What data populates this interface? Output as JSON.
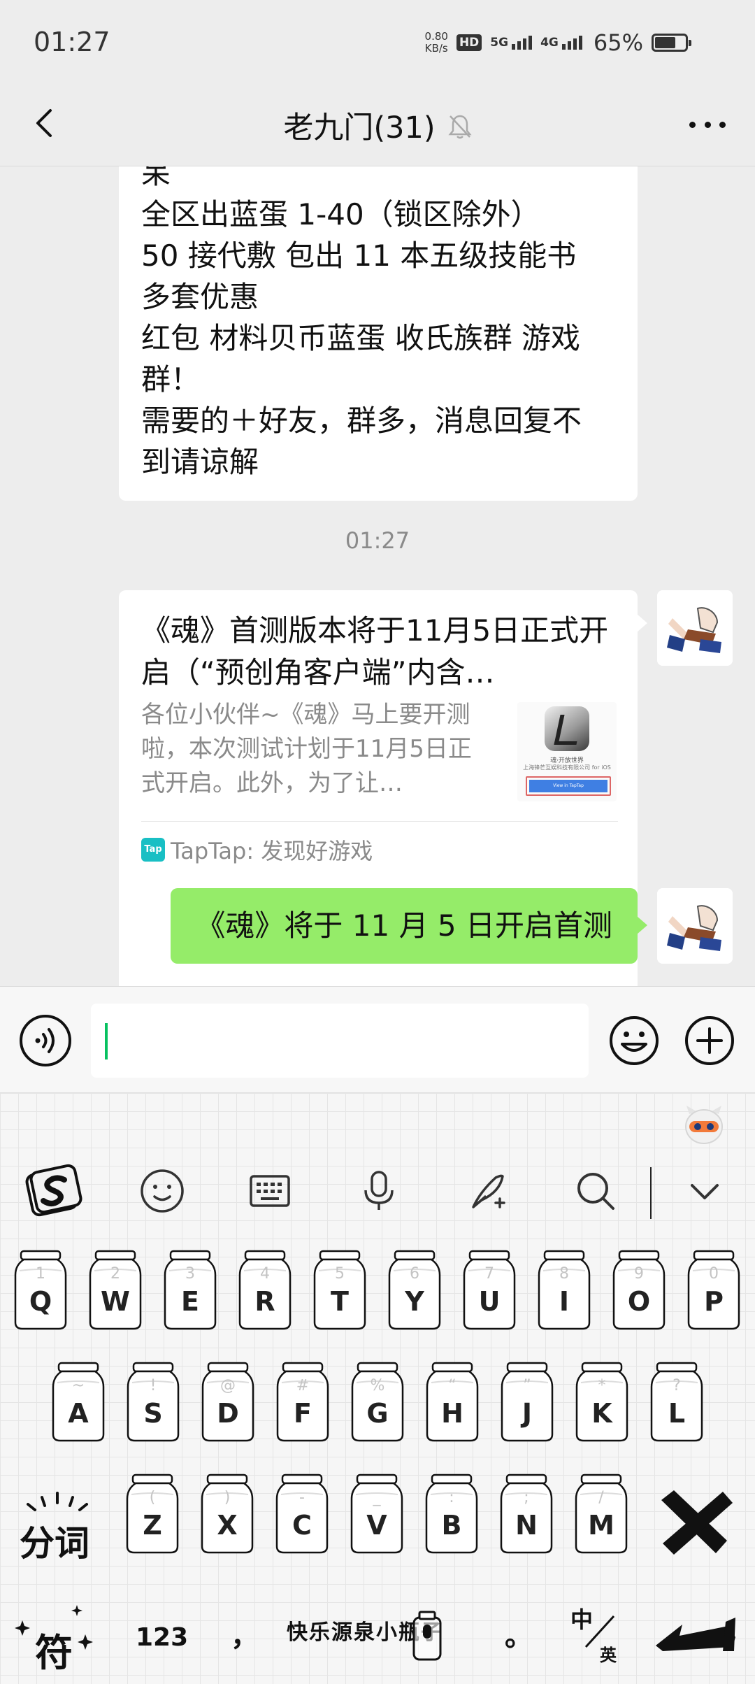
{
  "status": {
    "time": "01:27",
    "net_speed_value": "0.80",
    "net_speed_unit": "KB/s",
    "hd_label": "HD",
    "sim1": "5G",
    "sim2": "4G",
    "battery_percent": "65%",
    "battery_level": 0.65
  },
  "header": {
    "title": "老九门(31)"
  },
  "chat": {
    "prev_message_lines": [
      "呆",
      "全区出蓝蛋 1-40（锁区除外）",
      "50 接代敷 包出 11 本五级技能书",
      "多套优惠",
      "红包 材料贝币蓝蛋 收氏族群 游戏",
      "群！",
      "需要的＋好友，群多，消息回复不",
      "到请谅解"
    ],
    "timestamp": "01:27",
    "card": {
      "title": "《魂》首测版本将于11月5日正式开启（“预创角客户端”内含…",
      "description": "各位小伙伴~《魂》马上要开测啦，本次测试计划于11月5日正式开启。此外，为了让…",
      "thumb_line1": "魂·开放世界",
      "thumb_line2": "上海锋芒互娱科技有限公司 for iOS",
      "thumb_button": "View in TapTap",
      "source_logo": "Tap",
      "source": "TapTap: 发现好游戏"
    },
    "sent_message": "《魂》将于 11 月 5 日开启首测"
  },
  "keyboard": {
    "rows": [
      [
        {
          "k": "Q",
          "s": "1"
        },
        {
          "k": "W",
          "s": "2"
        },
        {
          "k": "E",
          "s": "3"
        },
        {
          "k": "R",
          "s": "4"
        },
        {
          "k": "T",
          "s": "5"
        },
        {
          "k": "Y",
          "s": "6"
        },
        {
          "k": "U",
          "s": "7"
        },
        {
          "k": "I",
          "s": "8"
        },
        {
          "k": "O",
          "s": "9"
        },
        {
          "k": "P",
          "s": "0"
        }
      ],
      [
        {
          "k": "A",
          "s": "~"
        },
        {
          "k": "S",
          "s": "!"
        },
        {
          "k": "D",
          "s": "@"
        },
        {
          "k": "F",
          "s": "#"
        },
        {
          "k": "G",
          "s": "%"
        },
        {
          "k": "H",
          "s": "“"
        },
        {
          "k": "J",
          "s": "”"
        },
        {
          "k": "K",
          "s": "*"
        },
        {
          "k": "L",
          "s": "?"
        }
      ],
      [
        {
          "k": "Z",
          "s": "("
        },
        {
          "k": "X",
          "s": ")"
        },
        {
          "k": "C",
          "s": "-"
        },
        {
          "k": "V",
          "s": "_"
        },
        {
          "k": "B",
          "s": ":"
        },
        {
          "k": "N",
          "s": ";"
        },
        {
          "k": "M",
          "s": "/"
        }
      ]
    ],
    "segment_label": "分词",
    "symbols_label": "符",
    "numbers_label": "123",
    "comma": "，",
    "space_label": "快乐源泉小瓶子",
    "period": "。",
    "lang_top": "中",
    "lang_bottom": "英"
  }
}
